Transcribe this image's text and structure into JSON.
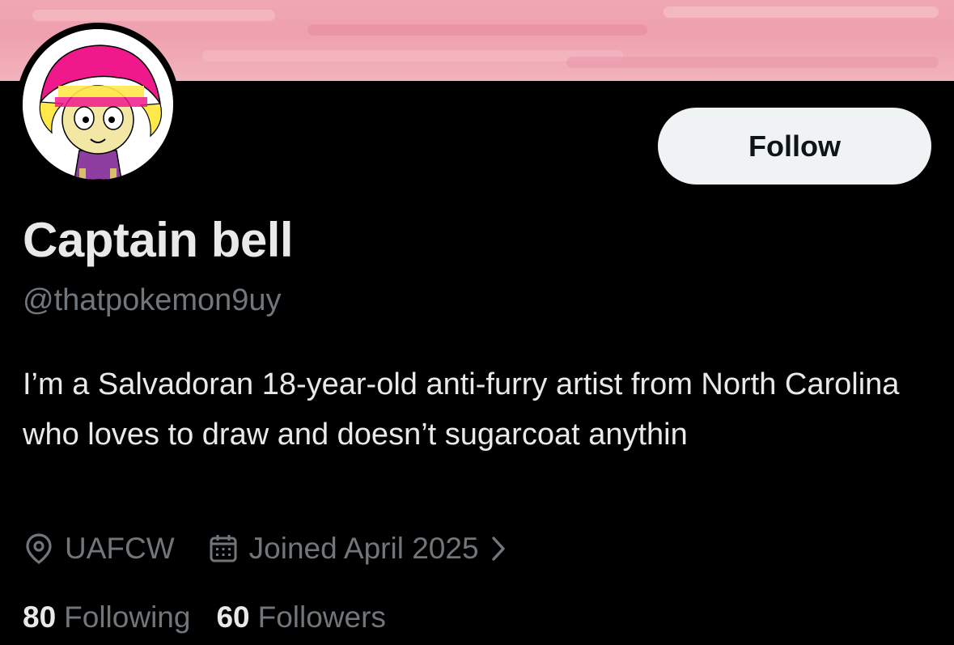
{
  "profile": {
    "display_name": "Captain bell",
    "handle": "@thatpokemon9uy",
    "bio": "I’m a Salvadoran 18-year-old anti-furry artist from North Carolina who loves to draw and doesn’t sugarcoat anythin",
    "location": "UAFCW",
    "joined": "Joined April 2025"
  },
  "actions": {
    "follow_label": "Follow"
  },
  "stats": {
    "following_count": "80",
    "following_label": "Following",
    "followers_count": "60",
    "followers_label": "Followers"
  },
  "icons": {
    "location": "location-pin-icon",
    "calendar": "calendar-icon",
    "chevron": "chevron-right-icon"
  },
  "colors": {
    "background": "#000000",
    "primary_text": "#e7e9ea",
    "secondary_text": "#71767b",
    "follow_button_bg": "#eff3f4",
    "banner": "#eea0ae"
  }
}
